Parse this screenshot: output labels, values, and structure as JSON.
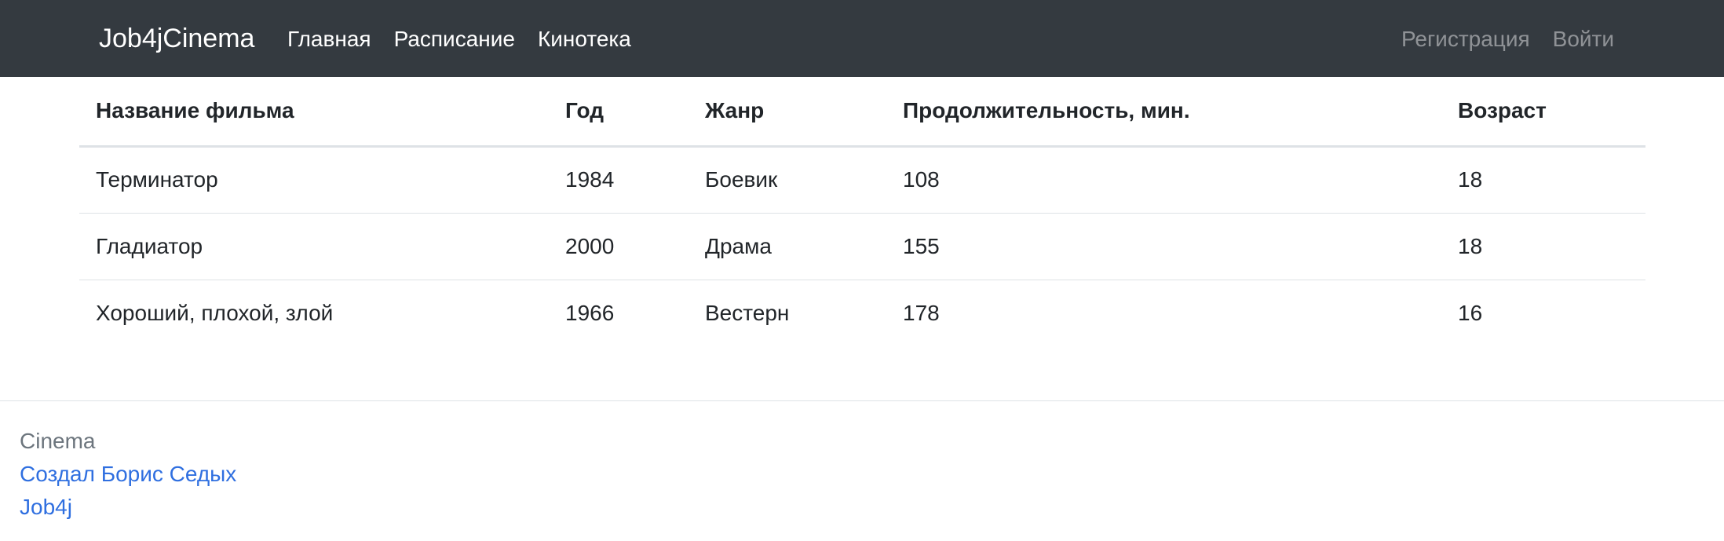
{
  "navbar": {
    "brand": "Job4jCinema",
    "links": [
      {
        "label": "Главная"
      },
      {
        "label": "Расписание"
      },
      {
        "label": "Кинотека"
      }
    ],
    "auth": {
      "register": "Регистрация",
      "login": "Войти"
    }
  },
  "films_table": {
    "headers": [
      "Название фильма",
      "Год",
      "Жанр",
      "Продолжительность, мин.",
      "Возраст"
    ],
    "rows": [
      [
        "Терминатор",
        "1984",
        "Боевик",
        "108",
        "18"
      ],
      [
        "Гладиатор",
        "2000",
        "Драма",
        "155",
        "18"
      ],
      [
        "Хороший, плохой, злой",
        "1966",
        "Вестерн",
        "178",
        "16"
      ]
    ]
  },
  "footer": {
    "title": "Cinema",
    "author": "Создал Борис Седых",
    "link": "Job4j"
  },
  "colors": {
    "navbar_bg": "#343a40",
    "link": "#2f6fe0",
    "muted": "#6c757d"
  }
}
